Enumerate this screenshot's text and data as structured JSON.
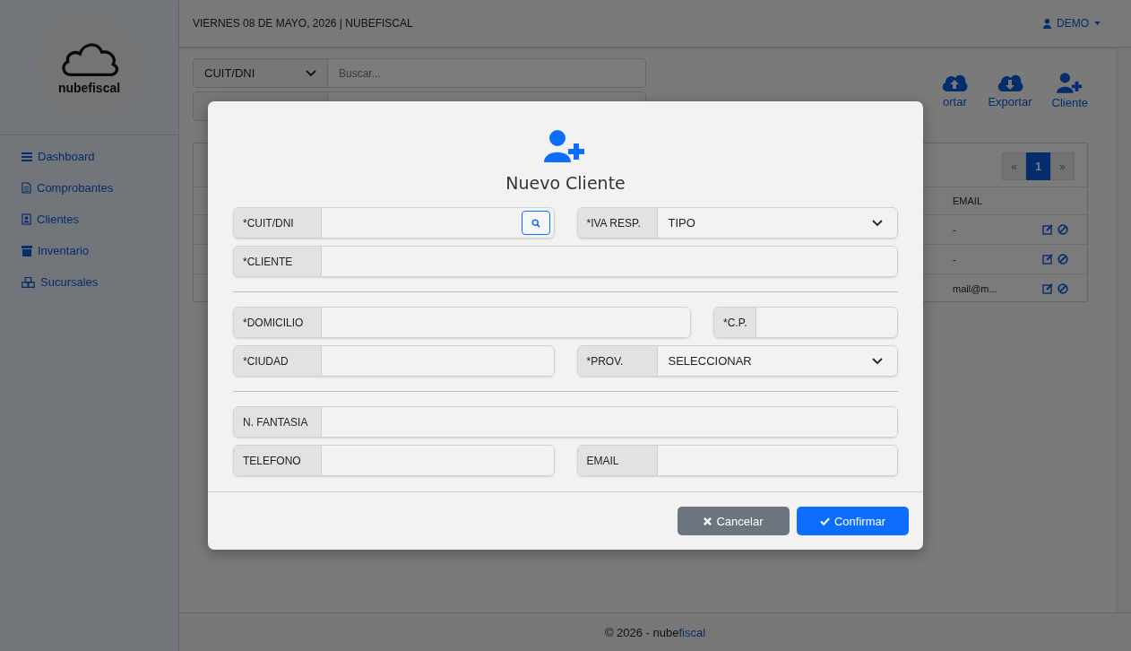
{
  "header": {
    "date": "VIERNES 08 DE MAYO, 2026 | NUBEFISCAL",
    "user": "DEMO"
  },
  "sidebar": {
    "logo": "nubefiscal",
    "items": [
      {
        "label": "Dashboard"
      },
      {
        "label": "Comprobantes"
      },
      {
        "label": "Clientes"
      },
      {
        "label": "Inventario"
      },
      {
        "label": "Sucursales"
      }
    ]
  },
  "toolbar": {
    "filter": "CUIT/DNI",
    "placeholder": "Buscar...",
    "actions": [
      "ortar",
      "Exportar",
      "Cliente"
    ]
  },
  "table": {
    "pagination": [
      {
        "label": "«",
        "selected": false
      },
      {
        "label": "1",
        "selected": true
      },
      {
        "label": "»",
        "selected": false
      }
    ],
    "column": "EMAIL",
    "rows": [
      {
        "email": "-"
      },
      {
        "email": "-"
      },
      {
        "email": "mail@m..."
      }
    ]
  },
  "modal": {
    "title": "Nuevo Cliente",
    "sections": [
      [
        [
          {
            "label": "*CUIT/DNI",
            "kind": "search"
          },
          {
            "label": "*IVA RESP.",
            "kind": "select",
            "value": "TIPO"
          }
        ],
        [
          {
            "label": "*CLIENTE",
            "kind": "text"
          }
        ]
      ],
      [
        [
          {
            "label": "*DOMICILIO",
            "kind": "text"
          },
          {
            "label": "*C.P.",
            "kind": "text"
          }
        ],
        [
          {
            "label": "*CIUDAD",
            "kind": "text"
          },
          {
            "label": "*PROV.",
            "kind": "select",
            "value": "SELECCIONAR"
          }
        ]
      ],
      [
        [
          {
            "label": "N. FANTASIA",
            "kind": "text"
          }
        ],
        [
          {
            "label": "TELEFONO",
            "kind": "text"
          },
          {
            "label": "EMAIL",
            "kind": "text"
          }
        ]
      ]
    ],
    "buttons": [
      {
        "label": "Cancelar",
        "kind": "cancel"
      },
      {
        "label": "Confirmar",
        "kind": "confirm"
      }
    ]
  },
  "footer": {
    "copyright": "© 2026 - nube",
    "brand": "fiscal"
  }
}
